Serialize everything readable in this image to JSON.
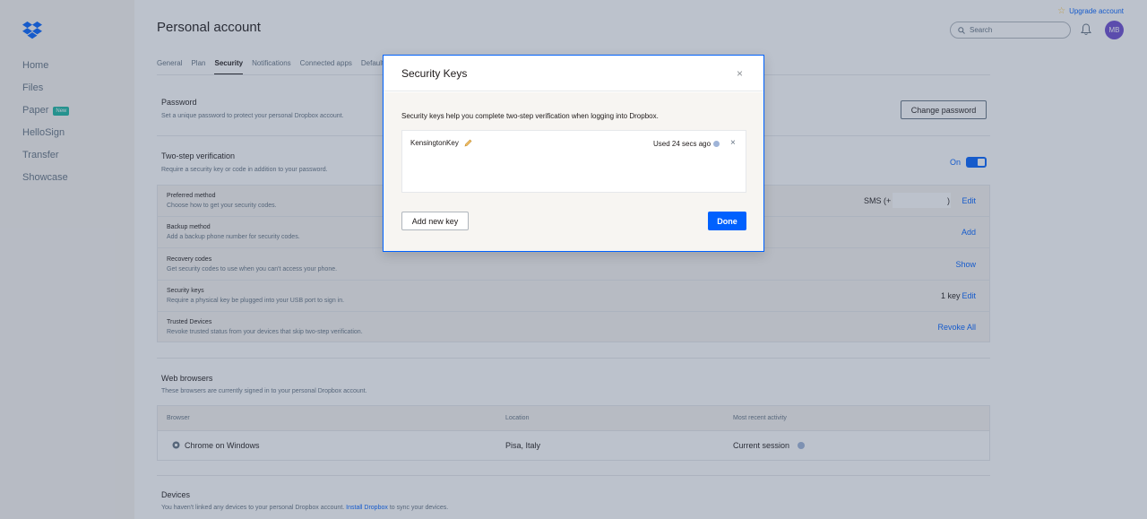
{
  "sidebar": {
    "items": [
      {
        "label": "Home"
      },
      {
        "label": "Files"
      },
      {
        "label": "Paper",
        "badge": "New"
      },
      {
        "label": "HelloSign"
      },
      {
        "label": "Transfer"
      },
      {
        "label": "Showcase"
      }
    ]
  },
  "header": {
    "title": "Personal account",
    "upgrade": "Upgrade account",
    "search_placeholder": "Search",
    "avatar_initials": "MB"
  },
  "tabs": [
    "General",
    "Plan",
    "Security",
    "Notifications",
    "Connected apps",
    "Default"
  ],
  "active_tab": "Security",
  "password": {
    "title": "Password",
    "desc": "Set a unique password to protect your personal Dropbox account.",
    "button": "Change password"
  },
  "two_step": {
    "title": "Two-step verification",
    "desc": "Require a security key or code in addition to your password.",
    "toggle_label": "On",
    "rows": [
      {
        "title": "Preferred method",
        "desc": "Choose how to get your security codes.",
        "value": "SMS (+",
        "value_suffix": ")",
        "action": "Edit"
      },
      {
        "title": "Backup method",
        "desc": "Add a backup phone number for security codes.",
        "value": "",
        "action": "Add"
      },
      {
        "title": "Recovery codes",
        "desc": "Get security codes to use when you can't access your phone.",
        "value": "",
        "action": "Show"
      },
      {
        "title": "Security keys",
        "desc": "Require a physical key be plugged into your USB port to sign in.",
        "value": "1 key",
        "action": "Edit"
      },
      {
        "title": "Trusted Devices",
        "desc": "Revoke trusted status from your devices that skip two-step verification.",
        "value": "",
        "action": "Revoke All"
      }
    ]
  },
  "web_browsers": {
    "title": "Web browsers",
    "desc": "These browsers are currently signed in to your personal Dropbox account.",
    "columns": [
      "Browser",
      "Location",
      "Most recent activity"
    ],
    "rows": [
      {
        "browser": "Chrome on Windows",
        "location": "Pisa, Italy",
        "activity": "Current session"
      }
    ]
  },
  "devices": {
    "title": "Devices",
    "desc": "You haven't linked any devices to your personal Dropbox account.",
    "link": "Install Dropbox",
    "desc_suffix": "to sync your devices."
  },
  "modal": {
    "title": "Security Keys",
    "close": "×",
    "desc": "Security keys help you complete two-step verification when logging into Dropbox.",
    "key_name": "KensingtonKey",
    "key_used": "Used 24 secs ago",
    "remove": "×",
    "add_button": "Add new key",
    "done_button": "Done"
  },
  "colors": {
    "accent": "#0061fe",
    "overlay": "#40506e"
  }
}
